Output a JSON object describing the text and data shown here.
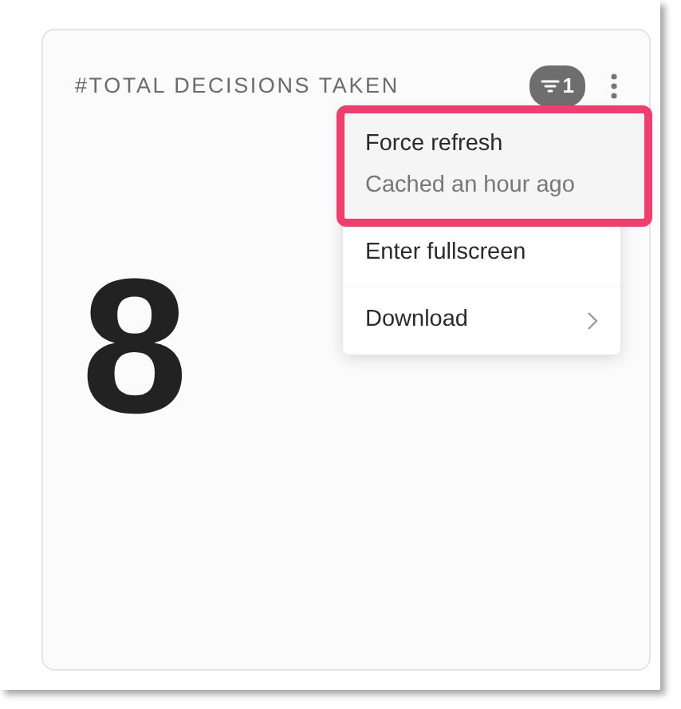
{
  "card": {
    "title": "#TOTAL DECISIONS TAKEN",
    "filter_count": "1",
    "value": "8"
  },
  "menu": {
    "items": [
      {
        "kind": "action",
        "label": "Force refresh",
        "sublabel": "Cached an hour ago",
        "highlighted": true,
        "divider_after": false,
        "submenu": false
      },
      {
        "kind": "action",
        "label": "Enter fullscreen",
        "highlighted": false,
        "divider_after": true,
        "submenu": false
      },
      {
        "kind": "action",
        "label": "Download",
        "highlighted": false,
        "divider_after": false,
        "submenu": true
      }
    ]
  }
}
